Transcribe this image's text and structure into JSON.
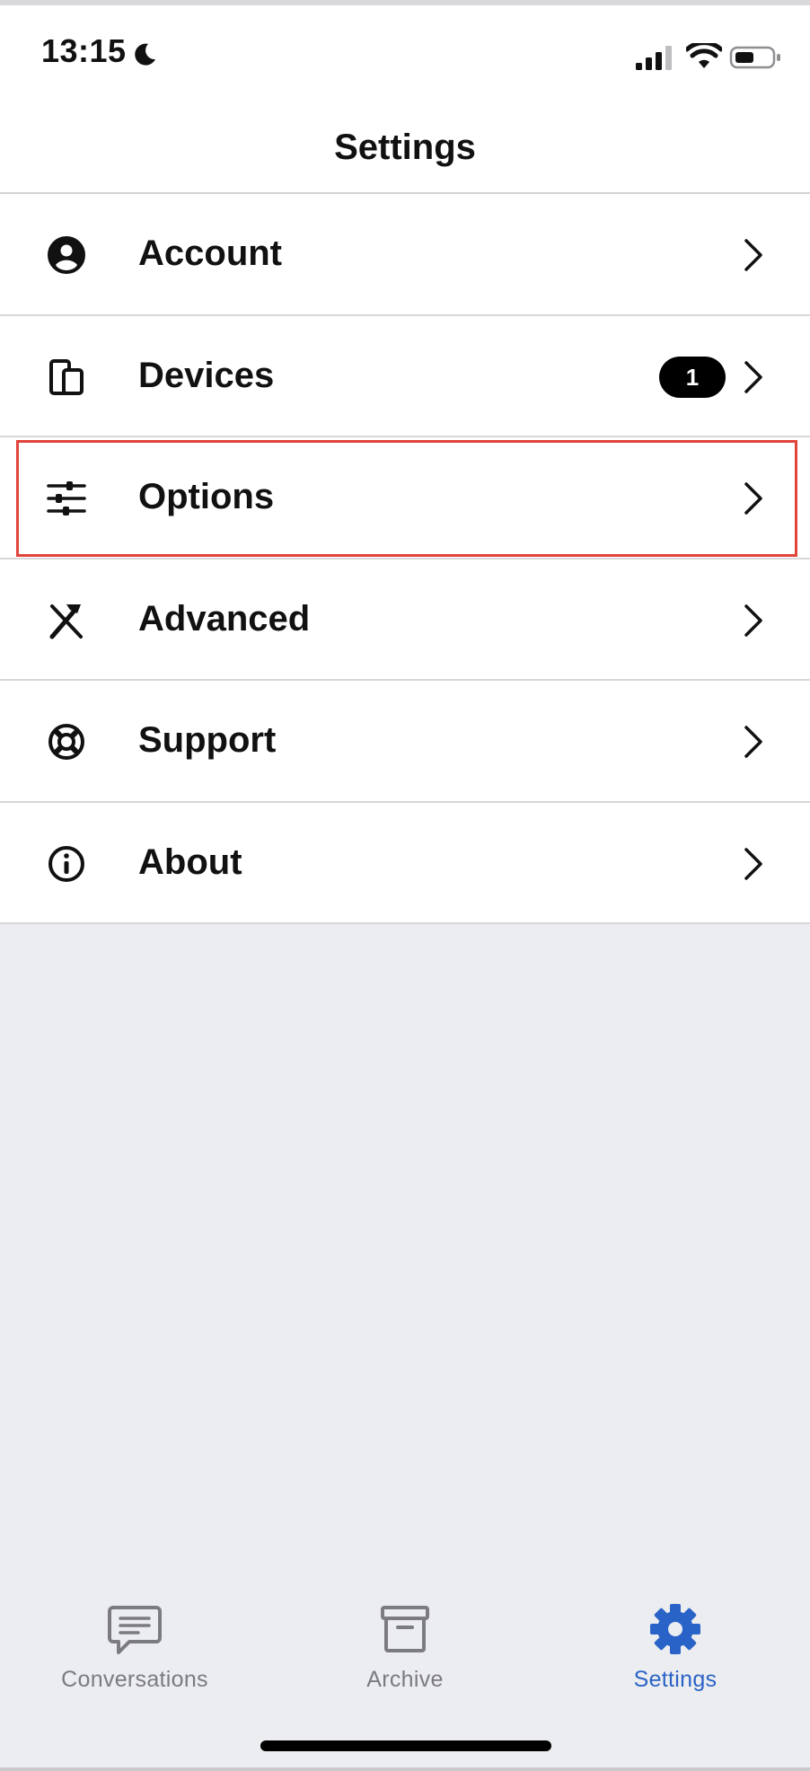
{
  "status_bar": {
    "time": "13:15",
    "icons": [
      "moon-icon",
      "cellular-signal-icon",
      "wifi-icon",
      "battery-icon"
    ]
  },
  "header": {
    "title": "Settings"
  },
  "settings_list": {
    "items": [
      {
        "label": "Account",
        "icon": "account-circle-icon"
      },
      {
        "label": "Devices",
        "icon": "devices-icon",
        "badge": "1"
      },
      {
        "label": "Options",
        "icon": "sliders-icon",
        "highlighted": true
      },
      {
        "label": "Advanced",
        "icon": "tools-icon"
      },
      {
        "label": "Support",
        "icon": "lifebuoy-icon"
      },
      {
        "label": "About",
        "icon": "info-icon"
      }
    ]
  },
  "tab_bar": {
    "tabs": [
      {
        "label": "Conversations",
        "icon": "chat-bubble-icon",
        "active": false
      },
      {
        "label": "Archive",
        "icon": "archive-box-icon",
        "active": false
      },
      {
        "label": "Settings",
        "icon": "gear-icon",
        "active": true
      }
    ]
  },
  "colors": {
    "accent": "#2a63c7",
    "highlight_border": "#e0443a",
    "background": "#ecedf0",
    "inactive_tab": "#7b7b80"
  }
}
